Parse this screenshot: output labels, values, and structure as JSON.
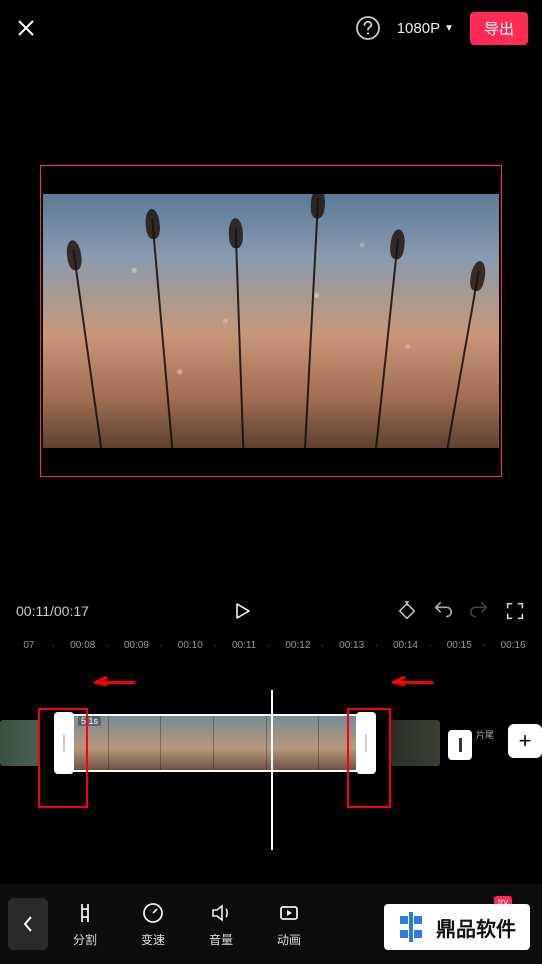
{
  "header": {
    "resolution": "1080P",
    "export_label": "导出"
  },
  "playback": {
    "current": "00:11",
    "total": "00:17"
  },
  "ruler": [
    "07",
    "00:08",
    "00:09",
    "00:10",
    "00:11",
    "00:12",
    "00:13",
    "00:14",
    "00:15",
    "00:16"
  ],
  "clip": {
    "duration_label": "5.1s",
    "end_label": "片尾"
  },
  "tools": {
    "split": "分割",
    "speed": "变速",
    "volume": "音量",
    "animation": "动画"
  },
  "watermark": {
    "text": "鼎品软件",
    "try": "try"
  }
}
